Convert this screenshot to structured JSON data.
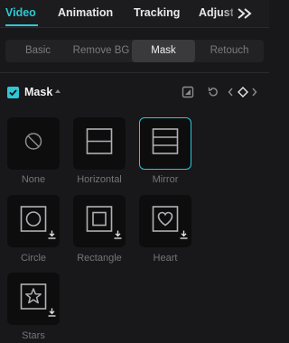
{
  "top_tabs": [
    {
      "label": "Video",
      "active": true
    },
    {
      "label": "Animation",
      "active": false
    },
    {
      "label": "Tracking",
      "active": false
    },
    {
      "label": "Adjustme",
      "active": false
    }
  ],
  "more_icon": "double-chevron-right-icon",
  "sub_tabs": [
    {
      "label": "Basic",
      "active": false
    },
    {
      "label": "Remove BG",
      "active": false
    },
    {
      "label": "Mask",
      "active": true
    },
    {
      "label": "Retouch",
      "active": false
    }
  ],
  "section": {
    "title": "Mask",
    "enabled": true,
    "actions": [
      "mask-toggle-icon",
      "reset-icon",
      "keyframe-icon"
    ]
  },
  "masks": [
    {
      "label": "None",
      "icon": "none-icon",
      "selected": false,
      "download": false
    },
    {
      "label": "Horizontal",
      "icon": "horizontal-icon",
      "selected": false,
      "download": false
    },
    {
      "label": "Mirror",
      "icon": "mirror-icon",
      "selected": true,
      "download": false
    },
    {
      "label": "Circle",
      "icon": "circle-icon",
      "selected": false,
      "download": true
    },
    {
      "label": "Rectangle",
      "icon": "rectangle-icon",
      "selected": false,
      "download": true
    },
    {
      "label": "Heart",
      "icon": "heart-icon",
      "selected": false,
      "download": true
    },
    {
      "label": "Stars",
      "icon": "star-icon",
      "selected": false,
      "download": true
    }
  ],
  "colors": {
    "accent": "#2ec7d4",
    "background": "#18181a",
    "tile": "#0d0d0e"
  }
}
